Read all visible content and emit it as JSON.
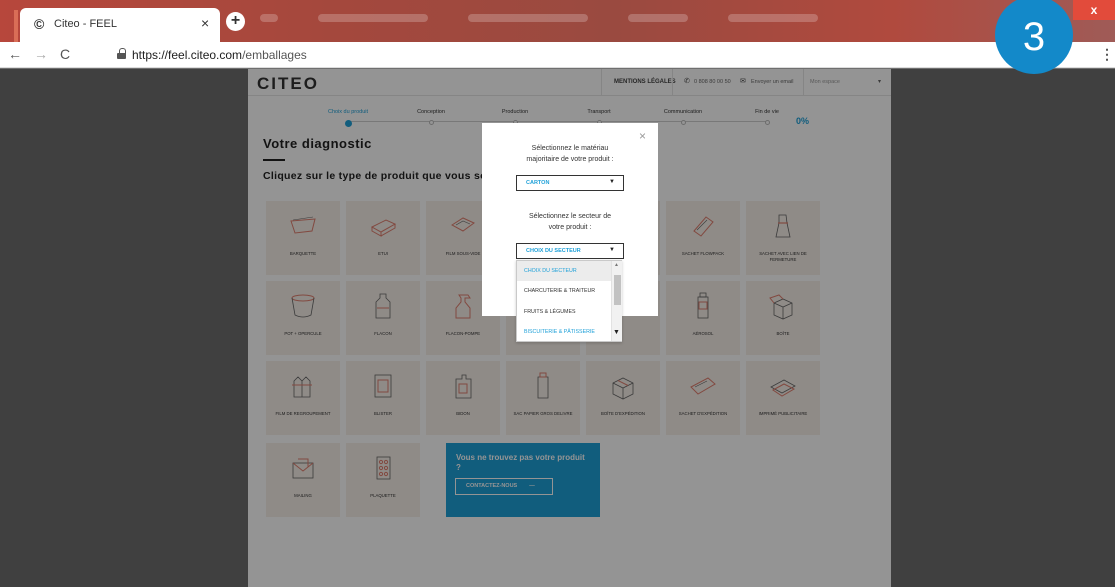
{
  "browser": {
    "tab_title": "Citeo - FEEL",
    "tab_close": "×",
    "new_tab": "+",
    "url_host": "https://feel.citeo.com",
    "url_path": "/emballages",
    "window_close": "x",
    "step_number": "3"
  },
  "header": {
    "logo": "CITEO",
    "mentions_label": "MENTIONS LÉGALES",
    "phone": "0 808 80 00 50",
    "email_label": "Envoyer un email",
    "space_select": "Mon espace"
  },
  "progress": {
    "steps": [
      "Choix du produit",
      "Conception",
      "Production",
      "Transport",
      "Communication",
      "Fin de vie"
    ],
    "active_index": 0,
    "percent": "0%"
  },
  "diagnostic": {
    "title": "Votre diagnostic",
    "subtitle": "Cliquez sur le type de produit que vous souh"
  },
  "products": [
    "BARQUETTE",
    "ETUI",
    "FILM SOUS-VIDE",
    "",
    "",
    "SACHET FLOWPACK",
    "SACHET AVEC LIEN DE FERMETURE",
    "POT + OPERCULE",
    "FLACON",
    "FLACON-POMPE",
    "",
    "TUBE",
    "AÉROSOL",
    "BOÎTE",
    "FILM DE REGROUPEMENT",
    "BLISTER",
    "BIDON",
    "SAC PAPIER GROS DELIVRE",
    "BOÎTE D'EXPÉDITION",
    "SACHET D'EXPÉDITION",
    "IMPRIMÉ PUBLICITAIRE",
    "MAILING",
    "PLAQUETTE"
  ],
  "cta": {
    "text": "Vous ne trouvez pas votre produit ?",
    "button": "CONTACTEZ-NOUS"
  },
  "modal": {
    "close": "×",
    "material_label": "Sélectionnez le matériau majoritaire de votre produit :",
    "material_value": "CARTON",
    "sector_label": "Sélectionnez le secteur de votre produit :",
    "sector_value": "CHOIX DU SECTEUR",
    "sector_options": [
      "CHOIX DU SECTEUR",
      "CHARCUTERIE & TRAITEUR",
      "FRUITS & LÉGUMES",
      "BISCUITERIE & PÂTISSERIE"
    ]
  },
  "colors": {
    "accent": "#1ea0d8",
    "tile_bg": "#f6efe9",
    "icon_stroke": "#e07f6f",
    "badge": "#1389c9"
  }
}
